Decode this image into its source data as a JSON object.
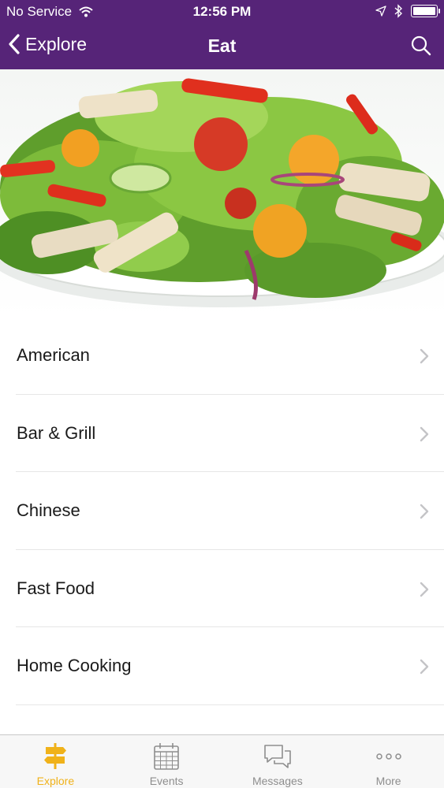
{
  "status": {
    "carrier": "No Service",
    "time": "12:56 PM"
  },
  "nav": {
    "back_label": "Explore",
    "title": "Eat"
  },
  "hero": {
    "subject": "salad-photo"
  },
  "categories": [
    {
      "label": "American"
    },
    {
      "label": "Bar & Grill"
    },
    {
      "label": "Chinese"
    },
    {
      "label": "Fast Food"
    },
    {
      "label": "Home Cooking"
    }
  ],
  "tabs": [
    {
      "label": "Explore",
      "icon": "signpost-icon",
      "active": true
    },
    {
      "label": "Events",
      "icon": "calendar-icon",
      "active": false
    },
    {
      "label": "Messages",
      "icon": "chat-bubbles-icon",
      "active": false
    },
    {
      "label": "More",
      "icon": "ellipsis-icon",
      "active": false
    }
  ],
  "colors": {
    "header": "#562478",
    "accent": "#f0b21a",
    "tab_inactive": "#8e8e8e"
  }
}
